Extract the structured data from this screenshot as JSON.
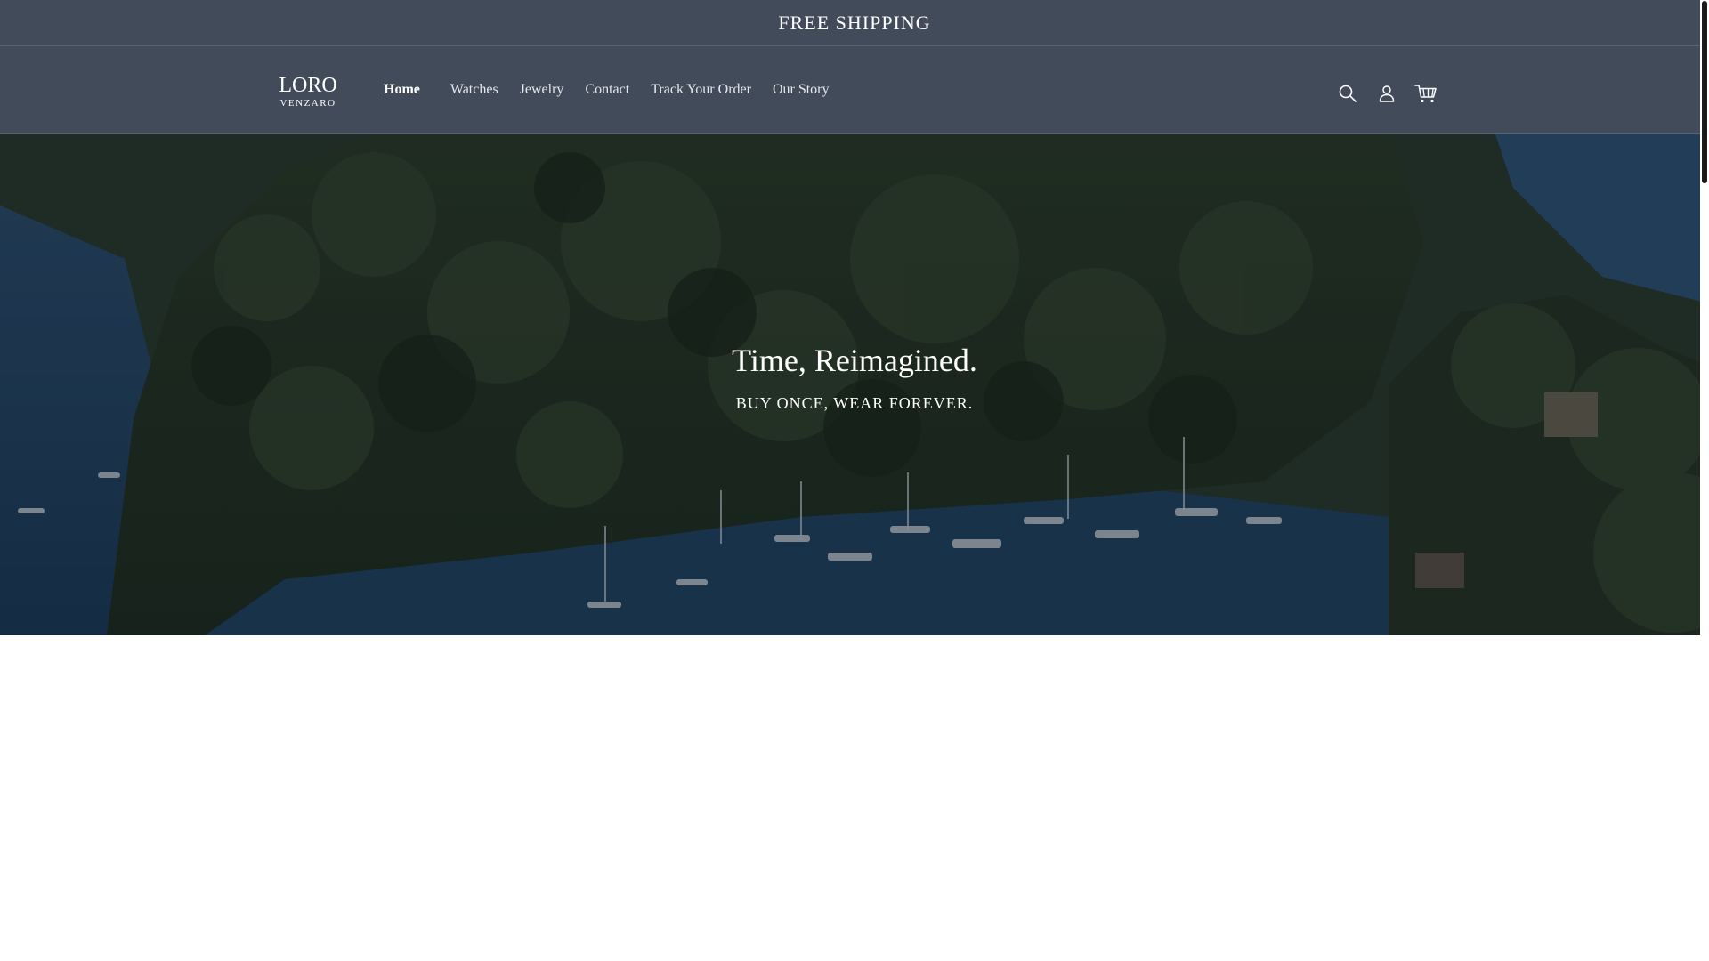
{
  "announcement": {
    "text": "FREE SHIPPING"
  },
  "header": {
    "logo": {
      "main": "LORO",
      "sub": "VENZARO"
    },
    "nav": [
      {
        "label": "Home",
        "active": true
      },
      {
        "label": "Watches",
        "active": false
      },
      {
        "label": "Jewelry",
        "active": false
      },
      {
        "label": "Contact",
        "active": false
      },
      {
        "label": "Track Your Order",
        "active": false
      },
      {
        "label": "Our Story",
        "active": false
      }
    ],
    "icons": [
      "search-icon",
      "account-icon",
      "cart-icon"
    ]
  },
  "hero": {
    "title": "Time, Reimagined.",
    "subtitle": "BUY ONCE, WEAR FOREVER.",
    "image": "coastal-village-harbor-photo"
  },
  "colors": {
    "header_bg": "#414b5a",
    "text": "#ffffff",
    "page_bg": "#ffffff"
  }
}
